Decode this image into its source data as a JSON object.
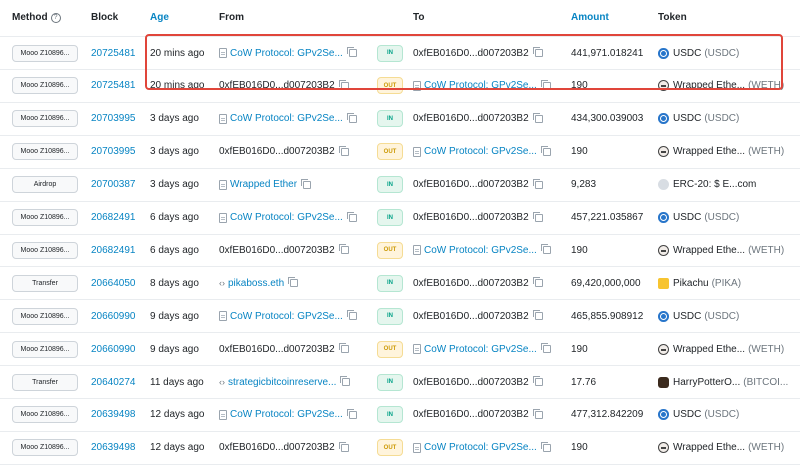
{
  "columns": {
    "method": "Method",
    "block": "Block",
    "age": "Age",
    "from": "From",
    "to": "To",
    "amount": "Amount",
    "token": "Token"
  },
  "rows": [
    {
      "method": "Mooo Z10896...",
      "block": "20725481",
      "age": "20 mins ago",
      "from": "CoW Protocol: GPv2Se...",
      "from_type": "contract",
      "dir": "IN",
      "to": "0xfEB016D0...d007203B2",
      "to_type": "plain",
      "amount": "441,971.018241",
      "token_icon": "usdc",
      "token_name": "USDC",
      "token_sym": "(USDC)"
    },
    {
      "method": "Mooo Z10896...",
      "block": "20725481",
      "age": "20 mins ago",
      "from": "0xfEB016D0...d007203B2",
      "from_type": "plain",
      "dir": "OUT",
      "to": "CoW Protocol: GPv2Se...",
      "to_type": "contract",
      "amount": "190",
      "token_icon": "weth",
      "token_name": "Wrapped Ethe...",
      "token_sym": "(WETH)"
    },
    {
      "method": "Mooo Z10896...",
      "block": "20703995",
      "age": "3 days ago",
      "from": "CoW Protocol: GPv2Se...",
      "from_type": "contract",
      "dir": "IN",
      "to": "0xfEB016D0...d007203B2",
      "to_type": "plain",
      "amount": "434,300.039003",
      "token_icon": "usdc",
      "token_name": "USDC",
      "token_sym": "(USDC)"
    },
    {
      "method": "Mooo Z10896...",
      "block": "20703995",
      "age": "3 days ago",
      "from": "0xfEB016D0...d007203B2",
      "from_type": "plain",
      "dir": "OUT",
      "to": "CoW Protocol: GPv2Se...",
      "to_type": "contract",
      "amount": "190",
      "token_icon": "weth",
      "token_name": "Wrapped Ethe...",
      "token_sym": "(WETH)"
    },
    {
      "method": "Airdrop",
      "block": "20700387",
      "age": "3 days ago",
      "from": "Wrapped Ether",
      "from_type": "contract",
      "dir": "IN",
      "to": "0xfEB016D0...d007203B2",
      "to_type": "plain",
      "amount": "9,283",
      "token_icon": "erc",
      "token_name": "ERC-20: $ E...com",
      "token_sym": ""
    },
    {
      "method": "Mooo Z10896...",
      "block": "20682491",
      "age": "6 days ago",
      "from": "CoW Protocol: GPv2Se...",
      "from_type": "contract",
      "dir": "IN",
      "to": "0xfEB016D0...d007203B2",
      "to_type": "plain",
      "amount": "457,221.035867",
      "token_icon": "usdc",
      "token_name": "USDC",
      "token_sym": "(USDC)"
    },
    {
      "method": "Mooo Z10896...",
      "block": "20682491",
      "age": "6 days ago",
      "from": "0xfEB016D0...d007203B2",
      "from_type": "plain",
      "dir": "OUT",
      "to": "CoW Protocol: GPv2Se...",
      "to_type": "contract",
      "amount": "190",
      "token_icon": "weth",
      "token_name": "Wrapped Ethe...",
      "token_sym": "(WETH)"
    },
    {
      "method": "Transfer",
      "block": "20664050",
      "age": "8 days ago",
      "from": "pikaboss.eth",
      "from_type": "code",
      "dir": "IN",
      "to": "0xfEB016D0...d007203B2",
      "to_type": "plain",
      "amount": "69,420,000,000",
      "token_icon": "pika",
      "token_name": "Pikachu",
      "token_sym": "(PIKA)"
    },
    {
      "method": "Mooo Z10896...",
      "block": "20660990",
      "age": "9 days ago",
      "from": "CoW Protocol: GPv2Se...",
      "from_type": "contract",
      "dir": "IN",
      "to": "0xfEB016D0...d007203B2",
      "to_type": "plain",
      "amount": "465,855.908912",
      "token_icon": "usdc",
      "token_name": "USDC",
      "token_sym": "(USDC)"
    },
    {
      "method": "Mooo Z10896...",
      "block": "20660990",
      "age": "9 days ago",
      "from": "0xfEB016D0...d007203B2",
      "from_type": "plain",
      "dir": "OUT",
      "to": "CoW Protocol: GPv2Se...",
      "to_type": "contract",
      "amount": "190",
      "token_icon": "weth",
      "token_name": "Wrapped Ethe...",
      "token_sym": "(WETH)"
    },
    {
      "method": "Transfer",
      "block": "20640274",
      "age": "11 days ago",
      "from": "strategicbitcoinreserve...",
      "from_type": "code",
      "dir": "IN",
      "to": "0xfEB016D0...d007203B2",
      "to_type": "plain",
      "amount": "17.76",
      "token_icon": "hp",
      "token_name": "HarryPotterO...",
      "token_sym": "(BITCOI..."
    },
    {
      "method": "Mooo Z10896...",
      "block": "20639498",
      "age": "12 days ago",
      "from": "CoW Protocol: GPv2Se...",
      "from_type": "contract",
      "dir": "IN",
      "to": "0xfEB016D0...d007203B2",
      "to_type": "plain",
      "amount": "477,312.842209",
      "token_icon": "usdc",
      "token_name": "USDC",
      "token_sym": "(USDC)"
    },
    {
      "method": "Mooo Z10896...",
      "block": "20639498",
      "age": "12 days ago",
      "from": "0xfEB016D0...d007203B2",
      "from_type": "plain",
      "dir": "OUT",
      "to": "CoW Protocol: GPv2Se...",
      "to_type": "contract",
      "amount": "190",
      "token_icon": "weth",
      "token_name": "Wrapped Ethe...",
      "token_sym": "(WETH)"
    }
  ],
  "colors": {
    "link": "#0784c3",
    "in_badge": "#00a186",
    "out_badge": "#cc9a06",
    "highlight": "#e0453a"
  }
}
